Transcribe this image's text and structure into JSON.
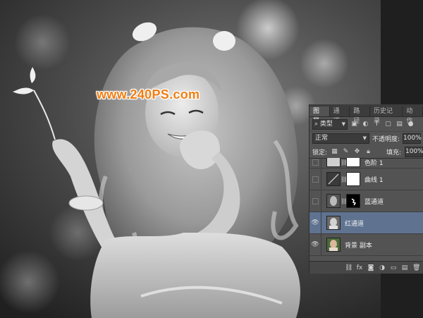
{
  "watermark": "www.240PS.com",
  "panel": {
    "tabs": [
      "图层",
      "通道",
      "路径",
      "历史记录",
      "动作"
    ],
    "active_tab": 0,
    "filter_kind": "类型",
    "blend_mode": "正常",
    "opacity_label": "不透明度:",
    "opacity_value": "100%",
    "lock_label": "锁定:",
    "fill_label": "填充:",
    "fill_value": "100%",
    "layers": [
      {
        "name": "色阶 1",
        "visible": false,
        "type": "adjustment",
        "selected": false
      },
      {
        "name": "曲线 1",
        "visible": false,
        "type": "adjustment",
        "selected": false
      },
      {
        "name": "蓝通道",
        "visible": false,
        "type": "image-mask",
        "selected": false
      },
      {
        "name": "红通道",
        "visible": true,
        "type": "image",
        "selected": true
      },
      {
        "name": "背景 副本",
        "visible": true,
        "type": "image-color",
        "selected": false
      }
    ]
  },
  "colors": {
    "panel_bg": "#535353",
    "selected_layer": "#5f7391",
    "watermark": "#f07d12"
  },
  "icons": {
    "eye": "eye-icon",
    "search": "search-icon",
    "lock": "lock-icon",
    "chain": "link-icon"
  }
}
